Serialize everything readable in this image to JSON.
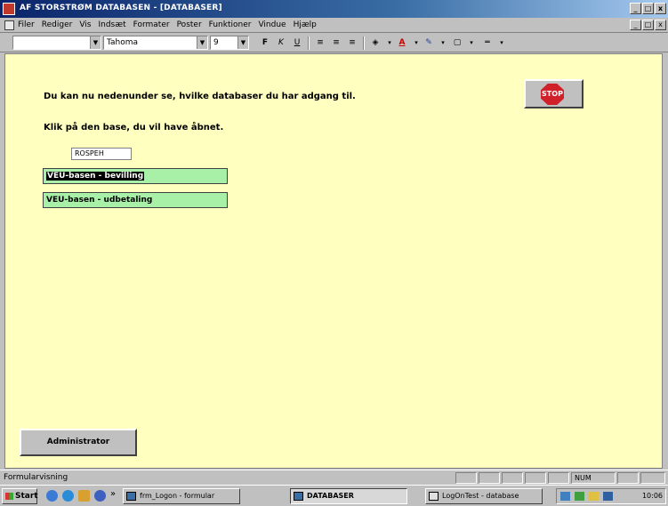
{
  "window": {
    "title": "AF STORSTRØM DATABASEN - [DATABASER]",
    "controls": [
      "_",
      "□",
      "x"
    ],
    "doc_controls": [
      "_",
      "□",
      "x"
    ]
  },
  "menubar": {
    "items": [
      "Filer",
      "Rediger",
      "Vis",
      "Indsæt",
      "Formater",
      "Poster",
      "Funktioner",
      "Vindue",
      "Hjælp"
    ]
  },
  "toolbar": {
    "object_combo": "",
    "font_combo": "Tahoma",
    "size_combo": "9",
    "bold": "F",
    "italic": "K",
    "underline": "U"
  },
  "form": {
    "heading1": "Du kan nu nedenunder se, hvilke databaser du har adgang til.",
    "heading2": "Klik på den base, du vil have åbnet.",
    "stop_label": "STOP",
    "user_id": "ROSPEH",
    "databases": [
      {
        "label": "VEU-basen - bevilling"
      },
      {
        "label": "VEU-basen - udbetaling"
      }
    ],
    "admin_button": "Administrator"
  },
  "statusbar": {
    "text": "Formularvisning",
    "num": "NUM"
  },
  "taskbar": {
    "start": "Start",
    "quicklaunch_more": "»",
    "tasks": [
      {
        "label": "frm_Logon - formular",
        "active": false
      },
      {
        "label": "DATABASER",
        "active": true
      },
      {
        "label": "LogOnTest - database",
        "active": false
      }
    ],
    "clock": "10:06"
  },
  "colors": {
    "form_background": "#ffffc0",
    "db_row": "#a8f0a8",
    "title_bar": "#0a246a",
    "stop_sign": "#d0202a"
  }
}
